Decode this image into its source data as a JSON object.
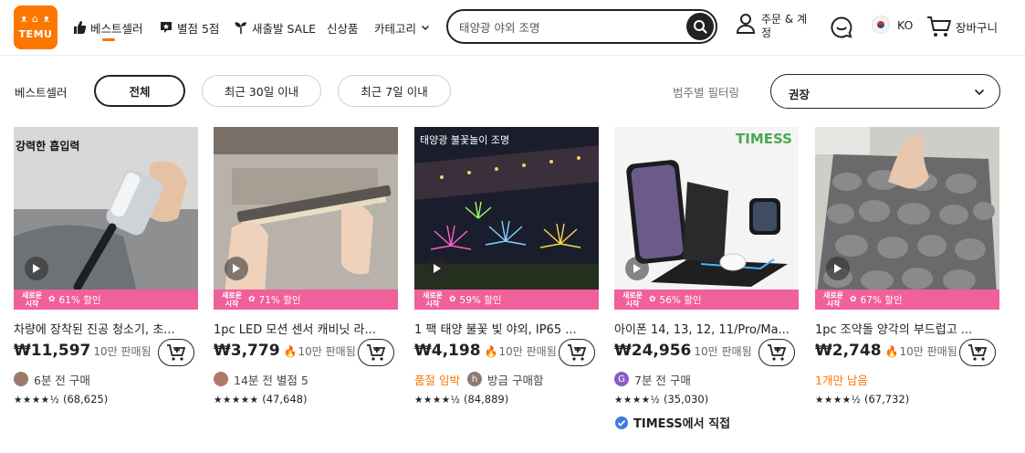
{
  "header": {
    "logo": {
      "glyphs": "ᴥ ⌂ ᴥ",
      "brand": "TEMU"
    },
    "nav": [
      {
        "label": "베스트셀러",
        "icon": "thumbs-up-icon"
      },
      {
        "label": "별점 5점",
        "icon": "star-review-icon"
      },
      {
        "label": "새출발 SALE",
        "icon": "sprout-icon"
      },
      {
        "label": "신상품",
        "icon": ""
      },
      {
        "label": "카테고리",
        "icon": "chevron-down-icon"
      }
    ],
    "search": {
      "value": "태양광 야외 조명"
    },
    "account": {
      "label": "주문 & 계정"
    },
    "language": {
      "code": "KO"
    },
    "cart": {
      "label": "장바구니"
    }
  },
  "filters": {
    "label": "베스트셀러",
    "chips": [
      "전체",
      "최근 30일 이내",
      "최근 7일 이내"
    ],
    "active_chip": "전체",
    "sort_label": "범주별 필터링",
    "sort_value": "권장"
  },
  "products": [
    {
      "image_text": "강력한 흡입력",
      "promo_tag_line1": "새로운",
      "promo_tag_line2": "시작",
      "discount": "61% 할인",
      "title": "차량에 장착된 진공 청소기, 초...",
      "price": "₩11,597",
      "sold": "10만 판매됨",
      "hot": false,
      "meta": "6분 전 구매",
      "meta_warn": "",
      "rating_count": "(68,625)",
      "stars": "★★★★½"
    },
    {
      "image_text": "",
      "promo_tag_line1": "새로운",
      "promo_tag_line2": "시작",
      "discount": "71% 할인",
      "title": "1pc LED 모션 센서 캐비닛 라...",
      "price": "₩3,779",
      "sold": "10만 판매됨",
      "hot": true,
      "meta": "14분 전 별점 5",
      "meta_warn": "",
      "rating_count": "(47,648)",
      "stars": "★★★★★"
    },
    {
      "image_text": "태양광 불꽃놀이 조명",
      "promo_tag_line1": "새로운",
      "promo_tag_line2": "시작",
      "discount": "59% 할인",
      "title": "1 팩 태양 불꽃 빛 야외, IP65 ...",
      "price": "₩4,198",
      "sold": "10만 판매됨",
      "hot": true,
      "meta": "방금 구매함",
      "meta_warn": "품절 임박",
      "rating_count": "(84,889)",
      "stars": "★★★★½"
    },
    {
      "image_text": "TIMESS",
      "promo_tag_line1": "새로운",
      "promo_tag_line2": "시작",
      "discount": "56% 할인",
      "title": "아이폰 14, 13, 12, 11/Pro/Ma...",
      "price": "₩24,956",
      "sold": "10만 판매됨",
      "hot": false,
      "meta": "7분 전 구매",
      "meta_warn": "",
      "rating_count": "(35,030)",
      "stars": "★★★★½",
      "seller": "TIMESS에서 직접"
    },
    {
      "image_text": "",
      "promo_tag_line1": "새로운",
      "promo_tag_line2": "시작",
      "discount": "67% 할인",
      "title": "1pc 조약돌 양각의 부드럽고 ...",
      "price": "₩2,748",
      "sold": "10만 판매됨",
      "hot": true,
      "meta": "",
      "meta_warn": "1개만 남음",
      "rating_count": "(67,732)",
      "stars": "★★★★½"
    }
  ],
  "colors": {
    "brand": "#fb7701",
    "promo": "#f0609a",
    "ink": "#222222"
  }
}
